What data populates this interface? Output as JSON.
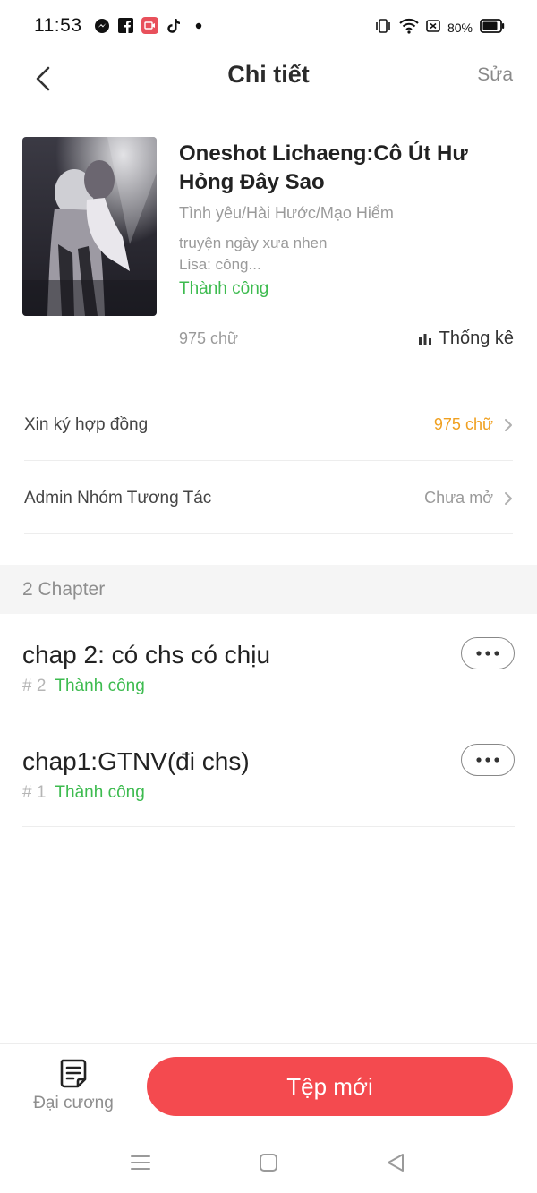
{
  "status_bar": {
    "time": "11:53",
    "battery": "80%",
    "left_icons": [
      "messenger-icon",
      "facebook-icon",
      "screen-record-icon",
      "tiktok-icon",
      "dot-icon"
    ],
    "right_icons": [
      "vibrate-icon",
      "wifi-icon",
      "sim-icon",
      "battery-icon"
    ]
  },
  "appbar": {
    "title": "Chi tiết",
    "edit_label": "Sửa",
    "back_icon": "chevron-left-icon"
  },
  "book": {
    "title": "Oneshot Lichaeng:Cô Út Hư Hỏng Đây Sao",
    "genre": "Tình yêu/Hài Hước/Mạo Hiểm",
    "desc_line1": "truyện ngày xưa nhen",
    "desc_line2": "Lisa: công...",
    "status": "Thành công",
    "word_count": "975 chữ",
    "stats_label": "Thống kê"
  },
  "rows": [
    {
      "label": "Xin ký hợp đồng",
      "value": "975 chữ"
    },
    {
      "label": "Admin Nhóm Tương Tác",
      "value": "Chưa mở"
    }
  ],
  "chapters": {
    "header": "2 Chapter",
    "items": [
      {
        "title": "chap 2: có chs có chịu",
        "num": "# 2",
        "status": "Thành công"
      },
      {
        "title": "chap1:GTNV(đi chs)",
        "num": "# 1",
        "status": "Thành công"
      }
    ]
  },
  "bottom": {
    "outline_label": "Đại cương",
    "new_file_label": "Tệp mới"
  },
  "colors": {
    "accent_red": "#f44a4f",
    "success_green": "#3dbb4f",
    "value_orange": "#f0a020"
  }
}
